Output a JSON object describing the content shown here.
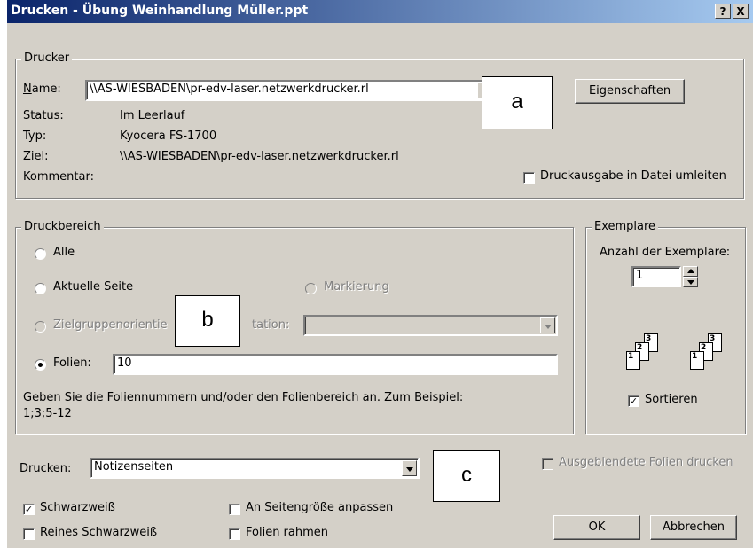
{
  "window": {
    "title": "Drucken - Übung Weinhandlung Müller.ppt",
    "help_label": "?",
    "close_label": "X"
  },
  "drucker": {
    "legend": "Drucker",
    "name_label": "Name:",
    "name_value": "\\\\AS-WIESBADEN\\pr-edv-laser.netzwerkdrucker.rl",
    "properties_button": "Eigenschaften",
    "status_label": "Status:",
    "status_value": "Im Leerlauf",
    "typ_label": "Typ:",
    "typ_value": "Kyocera FS-1700",
    "ziel_label": "Ziel:",
    "ziel_value": "\\\\AS-WIESBADEN\\pr-edv-laser.netzwerkdrucker.rl",
    "kommentar_label": "Kommentar:",
    "print_to_file_label": "Druckausgabe in Datei umleiten",
    "print_to_file_checked": false
  },
  "druckbereich": {
    "legend": "Druckbereich",
    "alle_label": "Alle",
    "aktuelle_label": "Aktuelle Seite",
    "markierung_label": "Markierung",
    "zielgruppe_label": "Zielgruppenorientierte Präsentation:",
    "zielgruppe_visible": "Zielgruppenorientie",
    "zielgruppe_tail": "tation:",
    "folien_label": "Folien:",
    "folien_value": "10",
    "selected": "Folien",
    "hint": "Geben Sie die Foliennummern und/oder den Folienbereich an. Zum Beispiel:",
    "hint2": "1;3;5-12"
  },
  "exemplare": {
    "legend": "Exemplare",
    "anzahl_label": "Anzahl der Exemplare:",
    "anzahl_value": "1",
    "sortieren_label": "Sortieren",
    "sortieren_checked": true,
    "page_numbers": [
      "1",
      "2",
      "3"
    ]
  },
  "drucken": {
    "label": "Drucken:",
    "value": "Notizenseiten",
    "ausgeblendete_label": "Ausgeblendete Folien drucken",
    "schwarzweiss_label": "Schwarzweiß",
    "schwarzweiss_checked": true,
    "reines_label": "Reines Schwarzweiß",
    "reines_checked": false,
    "seitengroesse_label": "An Seitengröße anpassen",
    "seitengroesse_checked": false,
    "rahmen_label": "Folien rahmen",
    "rahmen_checked": false
  },
  "buttons": {
    "ok": "OK",
    "cancel": "Abbrechen"
  },
  "callouts": {
    "a": "a",
    "b": "b",
    "c": "c"
  },
  "colors": {
    "dialog_bg": "#d4d0c8",
    "title_start": "#0a246a",
    "title_end": "#a6caf0"
  }
}
